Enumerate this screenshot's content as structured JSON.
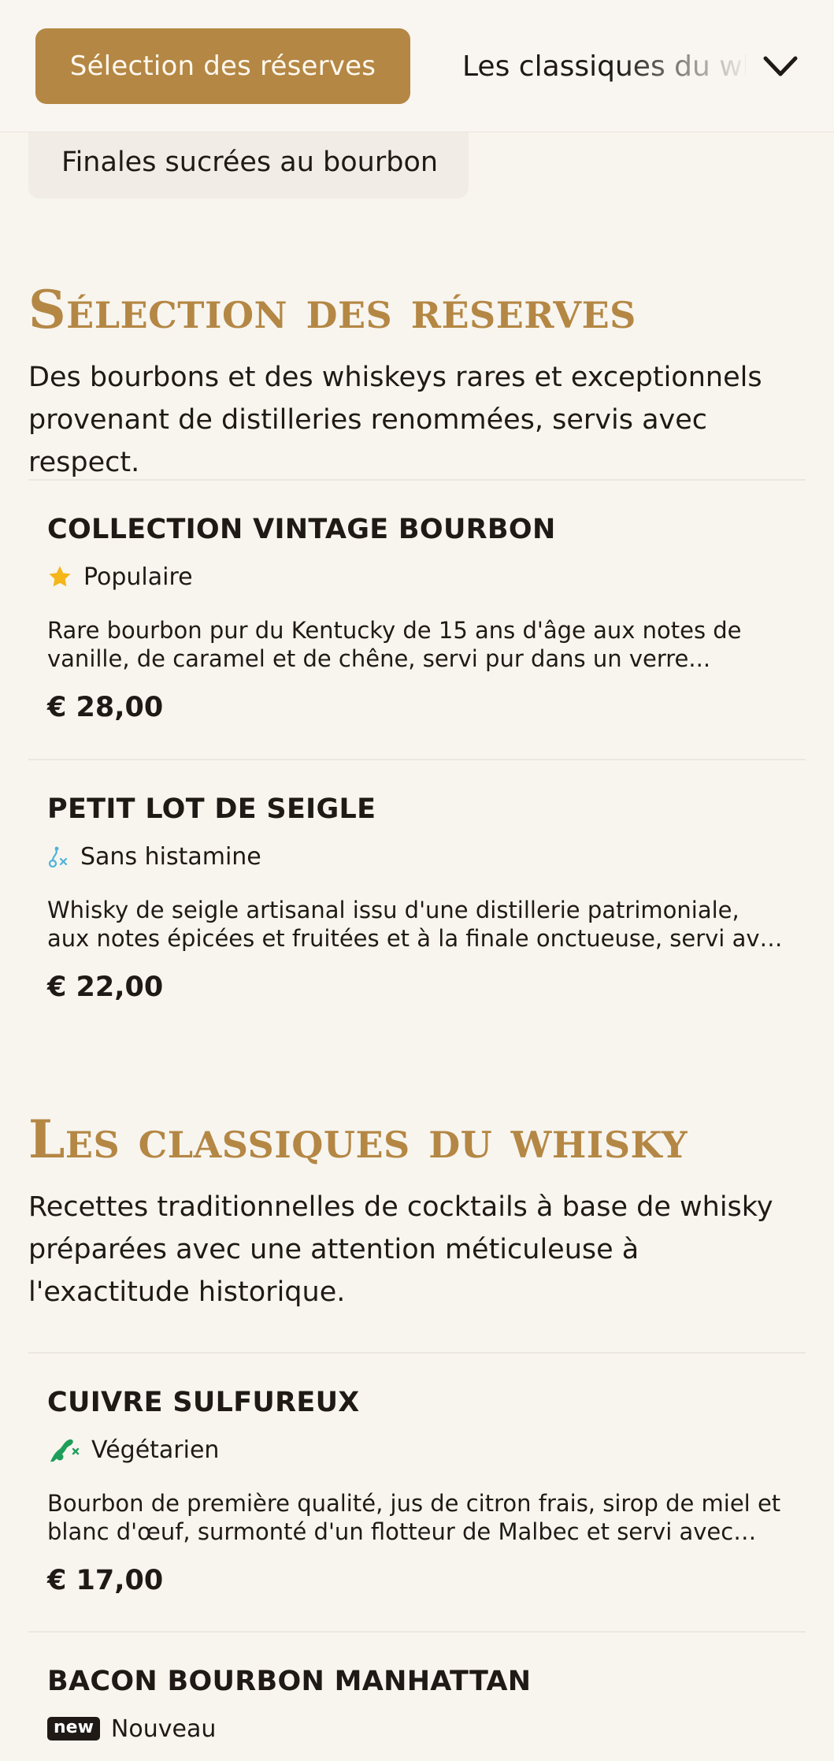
{
  "nav": {
    "active_category": "Sélection des réserves",
    "next_category": "Les classiques du whisky",
    "previous_category": "Finales sucrées au bourbon",
    "expand_icon": "chevron-down-icon"
  },
  "sections": [
    {
      "title": "Sélection des réserves",
      "description": "Des bourbons et des whiskeys rares et exceptionnels provenant de distilleries renommées, servis avec respect.",
      "items": [
        {
          "name": "COLLECTION VINTAGE BOURBON",
          "tag": "Populaire",
          "tag_icon": "star-icon",
          "description": "Rare bourbon pur du Kentucky de 15 ans d'âge aux notes de vanille, de caramel et de chêne, servi pur dans un verre...",
          "price": "€ 28,00"
        },
        {
          "name": "PETIT LOT DE SEIGLE",
          "tag": "Sans histamine",
          "tag_icon": "histamine-free-icon",
          "description": "Whisky de seigle artisanal issu d'une distillerie patrimoniale, aux notes épicées et fruitées et à la finale onctueuse, servi avec une...",
          "price": "€ 22,00"
        }
      ]
    },
    {
      "title": "Les classiques du whisky",
      "description": "Recettes traditionnelles de cocktails à base de whisky préparées avec une attention méticuleuse à l'exactitude historique.",
      "items": [
        {
          "name": "CUIVRE SULFUREUX",
          "tag": "Végétarien",
          "tag_icon": "vegetarian-icon",
          "description": "Bourbon de première qualité, jus de citron frais, sirop de miel et blanc d'œuf, surmonté d'un flotteur de Malbec et servi avec une...",
          "price": "€ 17,00"
        },
        {
          "name": "BACON BOURBON MANHATTAN",
          "tag": "Nouveau",
          "tag_badge": "new",
          "tag_icon": "new-badge-icon"
        }
      ]
    }
  ],
  "colors": {
    "accent": "#b48744",
    "background": "#f8f5ef",
    "star": "#f4b619",
    "histamine": "#4fb3d9",
    "vegetarian": "#1e9e5a"
  }
}
